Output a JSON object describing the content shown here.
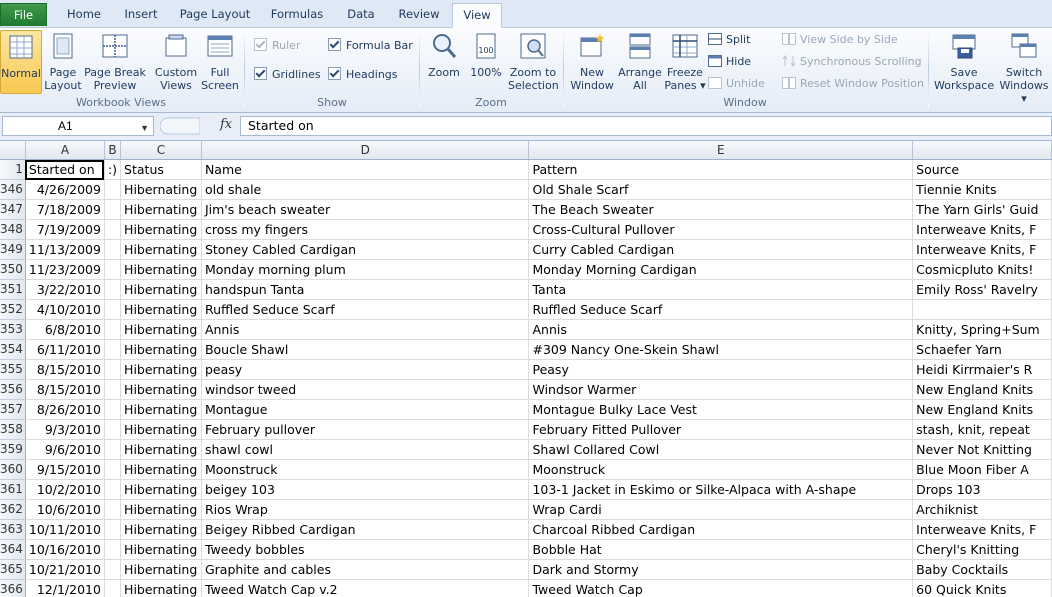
{
  "tabs": [
    "File",
    "Home",
    "Insert",
    "Page Layout",
    "Formulas",
    "Data",
    "Review",
    "View"
  ],
  "ribbon": {
    "workbook_views": {
      "label": "Workbook Views",
      "normal": "Normal",
      "page_layout": [
        "Page",
        "Layout"
      ],
      "page_break": [
        "Page Break",
        "Preview"
      ],
      "custom_views": [
        "Custom",
        "Views"
      ],
      "full_screen": [
        "Full",
        "Screen"
      ]
    },
    "show": {
      "label": "Show",
      "ruler": "Ruler",
      "formula_bar": "Formula Bar",
      "gridlines": "Gridlines",
      "headings": "Headings"
    },
    "zoom": {
      "label": "Zoom",
      "zoom": "Zoom",
      "hundred": "100%",
      "zoom_to_selection": [
        "Zoom to",
        "Selection"
      ]
    },
    "window": {
      "label": "Window",
      "new_window": [
        "New",
        "Window"
      ],
      "arrange_all": [
        "Arrange",
        "All"
      ],
      "freeze_panes": [
        "Freeze",
        "Panes ▾"
      ],
      "split": "Split",
      "hide": "Hide",
      "unhide": "Unhide",
      "side_by_side": "View Side by Side",
      "sync_scroll": "Synchronous Scrolling",
      "reset_pos": "Reset Window Position"
    },
    "save_workspace": [
      "Save",
      "Workspace"
    ],
    "switch_windows": [
      "Switch",
      "Windows ▾"
    ]
  },
  "formula_bar": {
    "name_box": "A1",
    "fx": "fx",
    "content": "Started on"
  },
  "grid": {
    "columns": [
      "A",
      "B",
      "C",
      "D",
      "E",
      ""
    ],
    "header_row": {
      "num": "1",
      "cells": [
        "Started on",
        ":)",
        "Status",
        "Name",
        "Pattern",
        "Source"
      ]
    },
    "rows": [
      [
        "346",
        "4/26/2009",
        "",
        "Hibernating",
        "old shale",
        "Old Shale Scarf",
        "Tiennie Knits"
      ],
      [
        "347",
        "7/18/2009",
        "",
        "Hibernating",
        "Jim's beach sweater",
        "The Beach Sweater",
        "The Yarn Girls' Guid"
      ],
      [
        "348",
        "7/19/2009",
        "",
        "Hibernating",
        "cross my fingers",
        "Cross-Cultural Pullover",
        "Interweave Knits, F"
      ],
      [
        "349",
        "11/13/2009",
        "",
        "Hibernating",
        "Stoney Cabled Cardigan",
        "Curry Cabled Cardigan",
        "Interweave Knits, F"
      ],
      [
        "350",
        "11/23/2009",
        "",
        "Hibernating",
        "Monday morning plum",
        "Monday Morning Cardigan",
        "Cosmicpluto Knits!"
      ],
      [
        "351",
        "3/22/2010",
        "",
        "Hibernating",
        "handspun Tanta",
        "Tanta",
        "Emily Ross' Ravelry"
      ],
      [
        "352",
        "4/10/2010",
        "",
        "Hibernating",
        "Ruffled Seduce Scarf",
        "Ruffled Seduce Scarf",
        ""
      ],
      [
        "353",
        "6/8/2010",
        "",
        "Hibernating",
        "Annis",
        "Annis",
        "Knitty, Spring+Sum"
      ],
      [
        "354",
        "6/11/2010",
        "",
        "Hibernating",
        "Boucle Shawl",
        "#309 Nancy One-Skein Shawl",
        "Schaefer Yarn"
      ],
      [
        "355",
        "8/15/2010",
        "",
        "Hibernating",
        "peasy",
        "Peasy",
        "Heidi Kirrmaier's R"
      ],
      [
        "356",
        "8/15/2010",
        "",
        "Hibernating",
        "windsor tweed",
        "Windsor Warmer",
        "New England Knits"
      ],
      [
        "357",
        "8/26/2010",
        "",
        "Hibernating",
        "Montague",
        "Montague Bulky Lace Vest",
        "New England Knits"
      ],
      [
        "358",
        "9/3/2010",
        "",
        "Hibernating",
        "February pullover",
        "February Fitted Pullover",
        "stash, knit, repeat"
      ],
      [
        "359",
        "9/6/2010",
        "",
        "Hibernating",
        "shawl cowl",
        "Shawl Collared Cowl",
        "Never Not Knitting"
      ],
      [
        "360",
        "9/15/2010",
        "",
        "Hibernating",
        "Moonstruck",
        "Moonstruck",
        "Blue Moon Fiber A"
      ],
      [
        "361",
        "10/2/2010",
        "",
        "Hibernating",
        "beigey 103",
        "103-1 Jacket in Eskimo or Silke-Alpaca with A-shape",
        "Drops 103"
      ],
      [
        "362",
        "10/6/2010",
        "",
        "Hibernating",
        "Rios Wrap",
        "Wrap Cardi",
        "Archiknist"
      ],
      [
        "363",
        "10/11/2010",
        "",
        "Hibernating",
        "Beigey Ribbed Cardigan",
        "Charcoal Ribbed Cardigan",
        "Interweave Knits, F"
      ],
      [
        "364",
        "10/16/2010",
        "",
        "Hibernating",
        "Tweedy bobbles",
        "Bobble Hat",
        "Cheryl's Knitting"
      ],
      [
        "365",
        "10/21/2010",
        "",
        "Hibernating",
        "Graphite and cables",
        "Dark and Stormy",
        "Baby Cocktails"
      ],
      [
        "366",
        "12/1/2010",
        "",
        "Hibernating",
        "Tweed Watch Cap v.2",
        "Tweed Watch Cap",
        "60 Quick Knits"
      ]
    ]
  }
}
